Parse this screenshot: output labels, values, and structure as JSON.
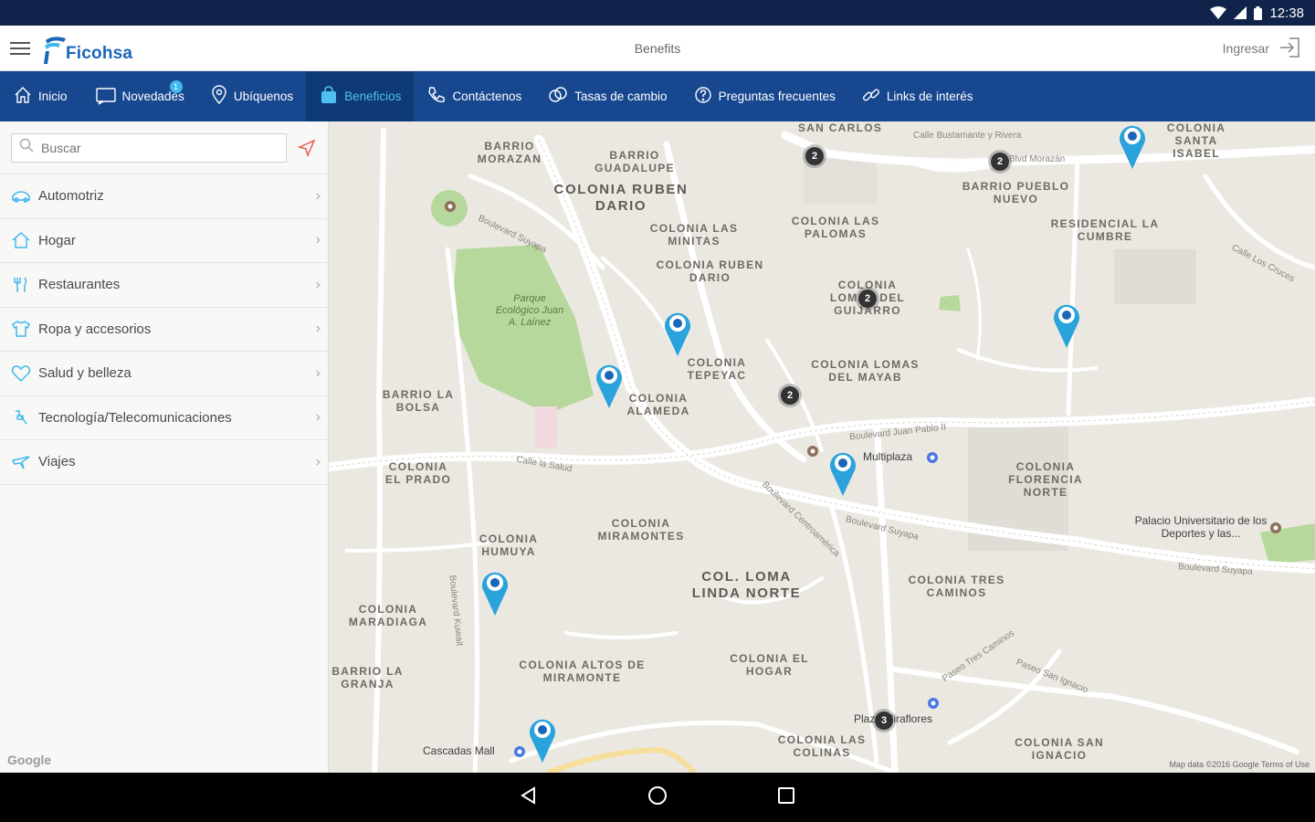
{
  "status_bar": {
    "time": "12:38"
  },
  "app_bar": {
    "brand": "Ficohsa",
    "title": "Benefits",
    "login_label": "Ingresar"
  },
  "nav": {
    "items": [
      {
        "label": "Inicio"
      },
      {
        "label": "Novedades",
        "badge": "1"
      },
      {
        "label": "Ubíquenos"
      },
      {
        "label": "Beneficios"
      },
      {
        "label": "Contáctenos"
      },
      {
        "label": "Tasas de cambio"
      },
      {
        "label": "Preguntas frecuentes"
      },
      {
        "label": "Links de interés"
      }
    ]
  },
  "sidebar": {
    "search_placeholder": "Buscar",
    "categories": [
      {
        "label": "Automotriz",
        "icon": "car-icon"
      },
      {
        "label": "Hogar",
        "icon": "home-icon"
      },
      {
        "label": "Restaurantes",
        "icon": "fork-icon"
      },
      {
        "label": "Ropa y accesorios",
        "icon": "shirt-icon"
      },
      {
        "label": "Salud y belleza",
        "icon": "heart-icon"
      },
      {
        "label": "Tecnología/Telecomunicaciones",
        "icon": "tech-icon"
      },
      {
        "label": "Viajes",
        "icon": "plane-icon"
      }
    ]
  },
  "map": {
    "areas": [
      "BARRIO MORAZAN",
      "BARRIO GUADALUPE",
      "COLONIA RUBEN DARIO",
      "COLONIA LAS MINITAS",
      "COLONIA RUBEN DARIO",
      "COLONIA LAS PALOMAS",
      "BARRIO PUEBLO NUEVO",
      "RESIDENCIAL LA CUMBRE",
      "COLONIA LOMAS DEL GUIJARRO",
      "COLONIA TEPEYAC",
      "COLONIA LOMAS DEL MAYAB",
      "BARRIO LA BOLSA",
      "COLONIA ALAMEDA",
      "COLONIA EL PRADO",
      "COLONIA FLORENCIA NORTE",
      "COLONIA MIRAMONTES",
      "COLONIA HUMUYA",
      "COL. LOMA LINDA NORTE",
      "COLONIA TRES CAMINOS",
      "COLONIA MARADIAGA",
      "COLONIA ALTOS DE MIRAMONTE",
      "BARRIO LA GRANJA",
      "COLONIA EL HOGAR",
      "COLONIA LAS COLINAS",
      "COLONIA SAN IGNACIO",
      "SAN CARLOS",
      "COLONIA SANTA ISABEL"
    ],
    "streets": [
      "Boulevard Suyapa",
      "Calle la Salud",
      "Boulevard Juan Pablo II",
      "Boulevard Centroamérica",
      "Boulevard Suyapa",
      "Boulevard Suyapa",
      "Paseo Tres Caminos",
      "Paseo San Ignacio",
      "Calle Bustamante y Rivera",
      "Blvd Morazán",
      "Boulevard Kuwait",
      "Calle Los Cruces"
    ],
    "pois": {
      "park": "Parque Ecológico Juan A. Laínez",
      "multiplaza": "Multiplaza",
      "palacio": "Palacio Universitario de los Deportes y las...",
      "cascadas": "Cascadas Mall",
      "plaza": "Plaza Miraflores"
    },
    "clusters": [
      "2",
      "2",
      "2",
      "2",
      "3"
    ],
    "footer": "Map data ©2016 Google   Terms of Use",
    "google": "Google"
  },
  "colors": {
    "nav_bg": "#16478f",
    "accent": "#4fc0ef",
    "pin": "#2aa3dc",
    "cluster": "#333333"
  }
}
